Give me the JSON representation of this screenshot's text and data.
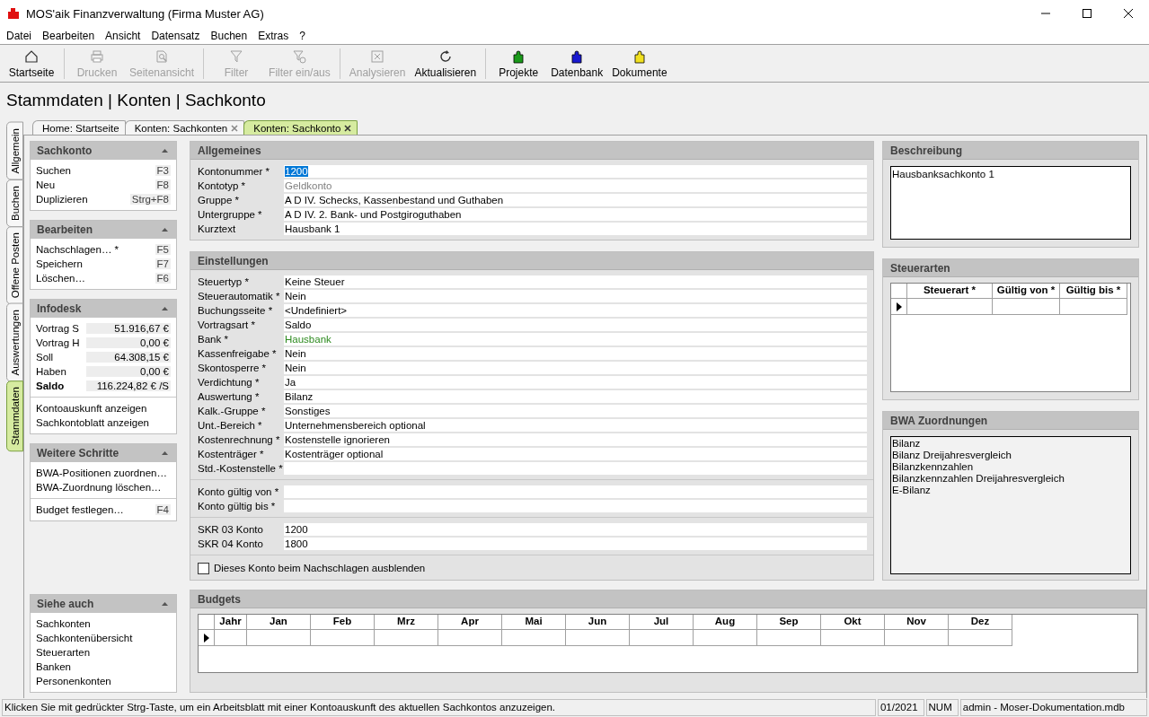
{
  "window": {
    "title": "MOS'aik Finanzverwaltung (Firma Muster AG)"
  },
  "menu": [
    "Datei",
    "Bearbeiten",
    "Ansicht",
    "Datensatz",
    "Buchen",
    "Extras",
    "?"
  ],
  "toolbar": [
    [
      {
        "label": "Startseite",
        "kind": "home",
        "disabled": false
      }
    ],
    [
      {
        "label": "Drucken",
        "kind": "print",
        "disabled": true
      },
      {
        "label": "Seitenansicht",
        "kind": "preview",
        "disabled": true
      }
    ],
    [
      {
        "label": "Filter",
        "kind": "filter",
        "disabled": true
      },
      {
        "label": "Filter ein/aus",
        "kind": "filter-toggle",
        "disabled": true
      }
    ],
    [
      {
        "label": "Analysieren",
        "kind": "analyze",
        "disabled": true
      },
      {
        "label": "Aktualisieren",
        "kind": "refresh",
        "disabled": false
      }
    ],
    [
      {
        "label": "Projekte",
        "kind": "puzzle",
        "color": "#1a9a1a",
        "disabled": false
      },
      {
        "label": "Datenbank",
        "kind": "puzzle",
        "color": "#1a1ad0",
        "disabled": false
      },
      {
        "label": "Dokumente",
        "kind": "puzzle",
        "color": "#f0e020",
        "disabled": false
      }
    ]
  ],
  "breadcrumb": "Stammdaten | Konten | Sachkonto",
  "side_tabs": [
    {
      "label": "Allgemein",
      "selected": false
    },
    {
      "label": "Buchen",
      "selected": false
    },
    {
      "label": "Offene Posten",
      "selected": false
    },
    {
      "label": "Auswertungen",
      "selected": false
    },
    {
      "label": "Stammdaten",
      "selected": true
    }
  ],
  "doc_tabs": [
    {
      "label": "Home: Startseite",
      "closable": false,
      "selected": false
    },
    {
      "label": "Konten: Sachkonten",
      "closable": true,
      "selected": false
    },
    {
      "label": "Konten: Sachkonto",
      "closable": true,
      "selected": true
    }
  ],
  "task_pane": [
    {
      "title": "Sachkonto",
      "expanded": true,
      "groups": [
        [
          {
            "kind": "link",
            "label": "Suchen",
            "shortcut": "F3"
          },
          {
            "kind": "link",
            "label": "Neu",
            "shortcut": "F8"
          },
          {
            "kind": "link",
            "label": "Duplizieren",
            "shortcut": "Strg+F8"
          }
        ]
      ]
    },
    {
      "title": "Bearbeiten",
      "expanded": true,
      "groups": [
        [
          {
            "kind": "link",
            "label": "Nachschlagen… *",
            "shortcut": "F5"
          },
          {
            "kind": "link",
            "label": "Speichern",
            "shortcut": "F7"
          },
          {
            "kind": "link",
            "label": "Löschen…",
            "shortcut": "F6"
          }
        ]
      ]
    },
    {
      "title": "Infodesk",
      "expanded": true,
      "groups": [
        [
          {
            "kind": "value",
            "label": "Vortrag S",
            "value": "51.916,67 €",
            "bold": false
          },
          {
            "kind": "value",
            "label": "Vortrag H",
            "value": "0,00 €",
            "bold": false
          },
          {
            "kind": "value",
            "label": "Soll",
            "value": "64.308,15 €",
            "bold": false
          },
          {
            "kind": "value",
            "label": "Haben",
            "value": "0,00 €",
            "bold": false
          },
          {
            "kind": "value",
            "label": "Saldo",
            "value": "116.224,82 € /S",
            "bold": true
          }
        ],
        [
          {
            "kind": "link",
            "label": "Kontoauskunft anzeigen"
          },
          {
            "kind": "link",
            "label": "Sachkontoblatt anzeigen"
          }
        ]
      ]
    },
    {
      "title": "Weitere Schritte",
      "expanded": true,
      "groups": [
        [
          {
            "kind": "link",
            "label": "BWA-Positionen zuordnen…"
          },
          {
            "kind": "link",
            "label": "BWA-Zuordnung löschen…"
          }
        ],
        [
          {
            "kind": "link",
            "label": "Budget festlegen…",
            "shortcut": "F4"
          }
        ]
      ]
    },
    {
      "title": "Siehe auch",
      "expanded": true,
      "bottom": true,
      "groups": [
        [
          {
            "kind": "link",
            "label": "Sachkonten"
          },
          {
            "kind": "link",
            "label": "Sachkontenübersicht"
          },
          {
            "kind": "link",
            "label": "Steuerarten"
          },
          {
            "kind": "link",
            "label": "Banken"
          },
          {
            "kind": "link",
            "label": "Personenkonten"
          }
        ]
      ]
    }
  ],
  "form_sections": [
    {
      "title": "Allgemeines",
      "groups": [
        [
          {
            "kind": "field",
            "label": "Kontonummer *",
            "value": "1200",
            "selected": true
          },
          {
            "kind": "field",
            "label": "Kontotyp *",
            "value": "Geldkonto",
            "disabled": true
          },
          {
            "kind": "field",
            "label": "Gruppe *",
            "value": "A D IV. Schecks, Kassenbestand und Guthaben"
          },
          {
            "kind": "field",
            "label": "Untergruppe *",
            "value": "A D IV. 2. Bank- und Postgiroguthaben"
          },
          {
            "kind": "field",
            "label": "Kurztext",
            "value": "Hausbank 1"
          }
        ]
      ]
    },
    {
      "title": "Einstellungen",
      "groups": [
        [
          {
            "kind": "field",
            "label": "Steuertyp *",
            "value": "Keine Steuer"
          },
          {
            "kind": "field",
            "label": "Steuerautomatik *",
            "value": "Nein"
          },
          {
            "kind": "field",
            "label": "Buchungsseite *",
            "value": "<Undefiniert>"
          },
          {
            "kind": "field",
            "label": "Vortragsart *",
            "value": "Saldo"
          },
          {
            "kind": "link-field",
            "label": "Bank *",
            "value": "Hausbank"
          },
          {
            "kind": "field",
            "label": "Kassenfreigabe *",
            "value": "Nein"
          },
          {
            "kind": "field",
            "label": "Skontosperre *",
            "value": "Nein"
          },
          {
            "kind": "field",
            "label": "Verdichtung *",
            "value": "Ja"
          },
          {
            "kind": "field",
            "label": "Auswertung *",
            "value": "Bilanz"
          },
          {
            "kind": "field",
            "label": "Kalk.-Gruppe *",
            "value": "Sonstiges"
          },
          {
            "kind": "field",
            "label": "Unt.-Bereich *",
            "value": "Unternehmensbereich optional"
          },
          {
            "kind": "field",
            "label": "Kostenrechnung *",
            "value": "Kostenstelle ignorieren"
          },
          {
            "kind": "field",
            "label": "Kostenträger *",
            "value": "Kostenträger optional"
          },
          {
            "kind": "field",
            "label": "Std.-Kostenstelle *"
          }
        ],
        [
          {
            "kind": "field",
            "label": "Konto gültig von *"
          },
          {
            "kind": "field",
            "label": "Konto gültig bis *"
          }
        ],
        [
          {
            "kind": "field",
            "label": "SKR 03 Konto",
            "value": "1200"
          },
          {
            "kind": "field",
            "label": "SKR 04 Konto",
            "value": "1800"
          }
        ],
        [
          {
            "kind": "checkbox",
            "label": "Dieses Konto beim Nachschlagen ausblenden",
            "checked": false
          }
        ]
      ]
    }
  ],
  "budgets": {
    "title": "Budgets",
    "columns": [
      "Jahr",
      "Jan",
      "Feb",
      "Mrz",
      "Apr",
      "Mai",
      "Jun",
      "Jul",
      "Aug",
      "Sep",
      "Okt",
      "Nov",
      "Dez"
    ],
    "rows": [
      {
        "current": true
      }
    ]
  },
  "beschreibung": {
    "title": "Beschreibung",
    "text": "Hausbanksachkonto 1"
  },
  "steuerarten": {
    "title": "Steuerarten",
    "columns": [
      "Steuerart *",
      "Gültig von *",
      "Gültig bis *"
    ],
    "rows": [
      {
        "current": true
      }
    ]
  },
  "bwa": {
    "title": "BWA Zuordnungen",
    "items": [
      "Bilanz",
      "Bilanz Dreijahresvergleich",
      "Bilanzkennzahlen",
      "Bilanzkennzahlen Dreijahresvergleich",
      "E-Bilanz"
    ]
  },
  "status_bar": {
    "message": "Klicken Sie mit gedrückter Strg-Taste, um ein Arbeitsblatt mit einer Kontoauskunft des aktuellen Sachkontos anzuzeigen.",
    "period": "01/2021",
    "mode": "NUM",
    "user": "admin - Moser-Dokumentation.mdb"
  }
}
